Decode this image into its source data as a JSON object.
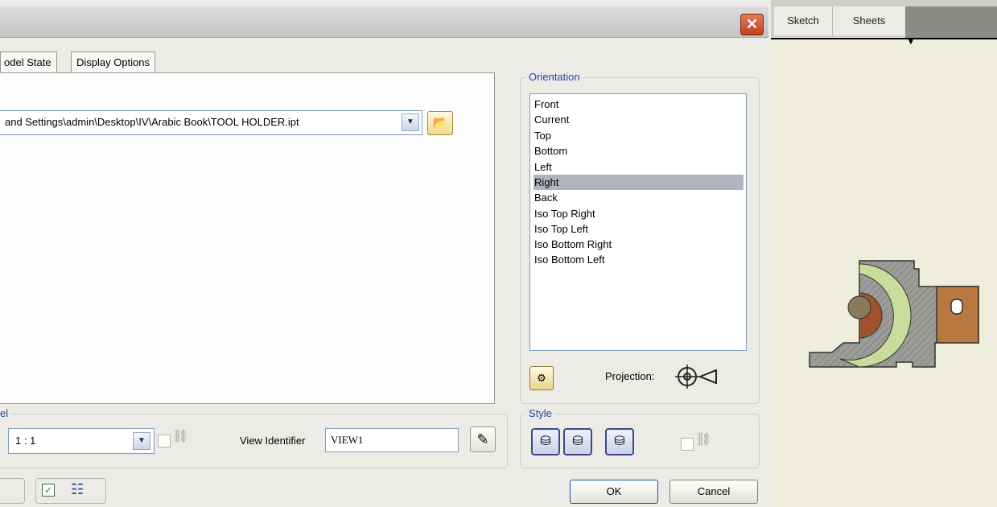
{
  "tabs": [
    {
      "label": "odel State"
    },
    {
      "label": "Display Options"
    }
  ],
  "file": {
    "path": "and Settings\\admin\\Desktop\\IV\\Arabic Book\\TOOL HOLDER.ipt"
  },
  "orientation": {
    "legend": "Orientation",
    "items": [
      "Front",
      "Current",
      "Top",
      "Bottom",
      "Left",
      "Right",
      "Back",
      "Iso Top Right",
      "Iso Top Left",
      "Iso Bottom Right",
      "Iso Bottom Left"
    ],
    "selected": "Right",
    "projection_label": "Projection:"
  },
  "style": {
    "legend": "Style"
  },
  "scale": {
    "legend": "el",
    "value": "1 : 1"
  },
  "view_identifier": {
    "label": "View Identifier",
    "value": "VIEW1"
  },
  "buttons": {
    "ok": "OK",
    "cancel": "Cancel"
  },
  "sheet": {
    "tabs": [
      "Sketch",
      "Sheets"
    ]
  },
  "colors": {
    "selection": "#b1b4c0",
    "accent": "#2346a8",
    "close": "#c1401c"
  }
}
